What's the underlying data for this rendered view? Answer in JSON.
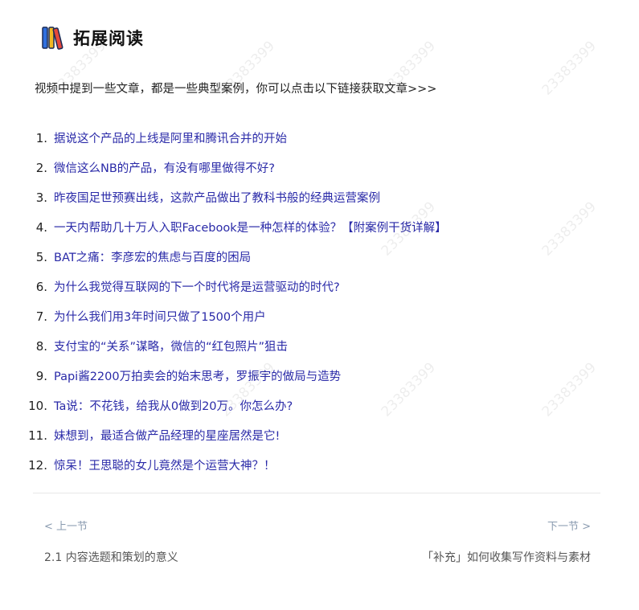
{
  "header": {
    "title": "拓展阅读",
    "logo_icon": "books-icon"
  },
  "intro": "视频中提到一些文章，都是一些典型案例，你可以点击以下链接获取文章>>>",
  "articles": [
    {
      "num": "1.",
      "title": "据说这个产品的上线是阿里和腾讯合并的开始"
    },
    {
      "num": "2.",
      "title": "微信这么NB的产品，有没有哪里做得不好?"
    },
    {
      "num": "3.",
      "title": "昨夜国足世预赛出线，这款产品做出了教科书般的经典运营案例"
    },
    {
      "num": "4.",
      "title": "一天内帮助几十万人入职Facebook是一种怎样的体验？【附案例干货详解】"
    },
    {
      "num": "5.",
      "title": "BAT之痛：李彦宏的焦虑与百度的困局"
    },
    {
      "num": "6.",
      "title": "为什么我觉得互联网的下一个时代将是运营驱动的时代?"
    },
    {
      "num": "7.",
      "title": "为什么我们用3年时间只做了1500个用户"
    },
    {
      "num": "8.",
      "title": "支付宝的“关系”谋略，微信的“红包照片”狙击"
    },
    {
      "num": "9.",
      "title": "Papi酱2200万拍卖会的始末思考，罗振宇的做局与造势"
    },
    {
      "num": "10.",
      "title": "Ta说：不花钱，给我从0做到20万。你怎么办?"
    },
    {
      "num": "11.",
      "title": "妹想到，最适合做产品经理的星座居然是它!"
    },
    {
      "num": "12.",
      "title": "惊呆！王思聪的女儿竟然是个运营大神？！"
    }
  ],
  "nav": {
    "prev_label": "< 上一节",
    "next_label": "下一节 >",
    "prev_title": "2.1 内容选题和策划的意义",
    "next_title": "「补充」如何收集写作资料与素材"
  },
  "watermark": "23383399",
  "colors": {
    "link": "#2a2aa8",
    "nav": "#8a9bb0",
    "logo_blue": "#2f6fdf",
    "logo_yellow": "#f2b824",
    "logo_red": "#e5483b"
  }
}
